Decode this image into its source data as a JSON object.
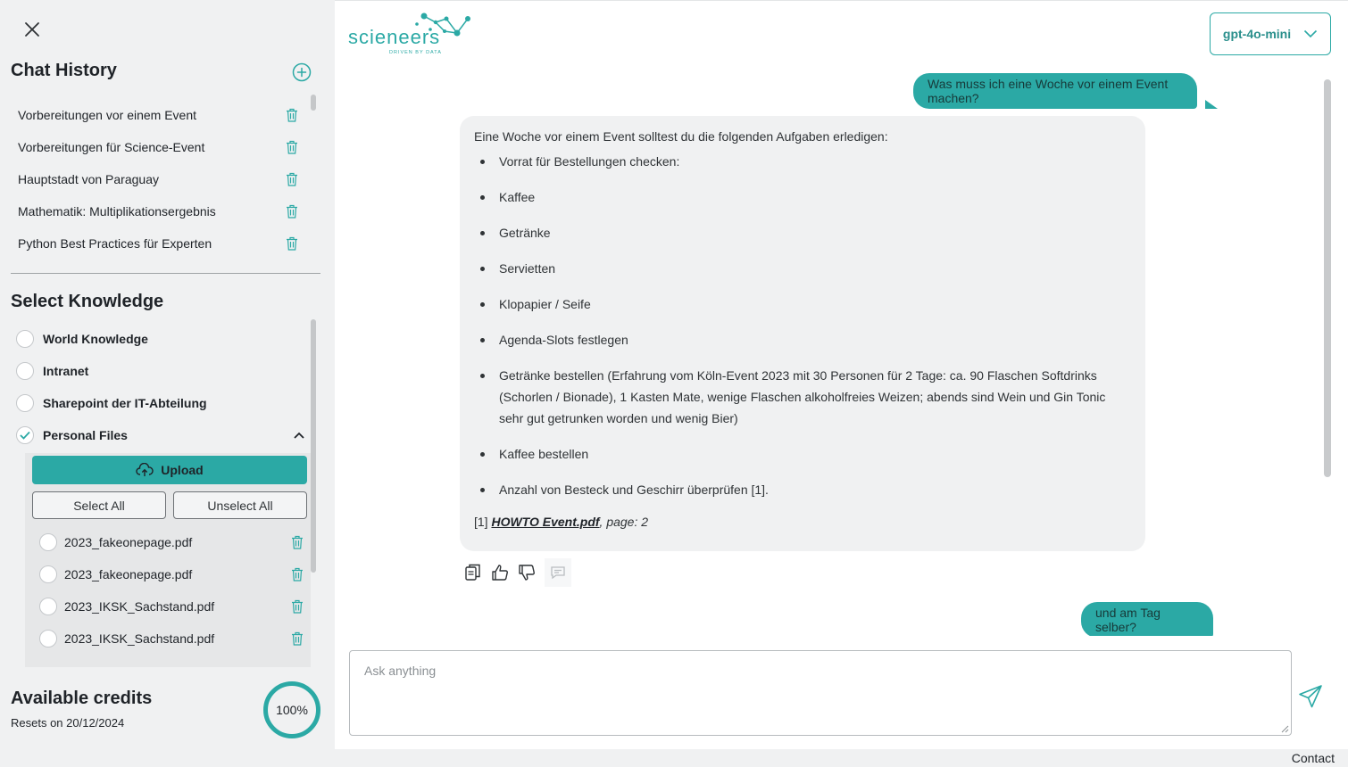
{
  "sidebar": {
    "chat_history_title": "Chat History",
    "history": [
      "Vorbereitungen vor einem Event",
      "Vorbereitungen für Science-Event",
      "Hauptstadt von Paraguay",
      "Mathematik: Multiplikationsergebnis",
      "Python Best Practices für Experten"
    ],
    "knowledge_title": "Select Knowledge",
    "knowledge": [
      {
        "label": "World Knowledge",
        "checked": false
      },
      {
        "label": "Intranet",
        "checked": false
      },
      {
        "label": "Sharepoint der IT-Abteilung",
        "checked": false
      },
      {
        "label": "Personal Files",
        "checked": true
      }
    ],
    "upload_label": "Upload",
    "select_all_label": "Select All",
    "unselect_all_label": "Unselect All",
    "files": [
      "2023_fakeonepage.pdf",
      "2023_fakeonepage.pdf",
      "2023_IKSK_Sachstand.pdf",
      "2023_IKSK_Sachstand.pdf"
    ],
    "credits_title": "Available credits",
    "credits_reset": "Resets on 20/12/2024",
    "credits_percent": "100%"
  },
  "header": {
    "logo_text": "scieneers",
    "logo_tagline": "DRIVEN BY DATA",
    "model": "gpt-4o-mini"
  },
  "chat": {
    "user_message_1": "Was muss ich eine Woche vor einem Event machen?",
    "bot_intro": "Eine Woche vor einem Event solltest du die folgenden Aufgaben erledigen:",
    "bot_items": [
      "Vorrat für Bestellungen checken:",
      "Kaffee",
      "Getränke",
      "Servietten",
      "Klopapier / Seife",
      "Agenda-Slots festlegen",
      "Getränke bestellen (Erfahrung vom Köln-Event 2023 mit 30 Personen für 2 Tage: ca. 90 Flaschen Softdrinks (Schorlen / Bionade), 1 Kasten Mate, wenige Flaschen alkoholfreies Weizen; abends sind Wein und Gin Tonic sehr gut getrunken worden und wenig Bier)",
      "Kaffee bestellen",
      "Anzahl von Besteck und Geschirr überprüfen [1]."
    ],
    "source_ref": "[1]",
    "source_link": "HOWTO Event.pdf",
    "source_page": ", page: 2",
    "user_message_2": "und am Tag selber?"
  },
  "input": {
    "placeholder": "Ask anything"
  },
  "footer": {
    "contact": "Contact"
  },
  "colors": {
    "accent": "#2ba9a5",
    "sidebar_bg": "#f0f1f2",
    "bubble_bg": "#f0f1f2"
  }
}
